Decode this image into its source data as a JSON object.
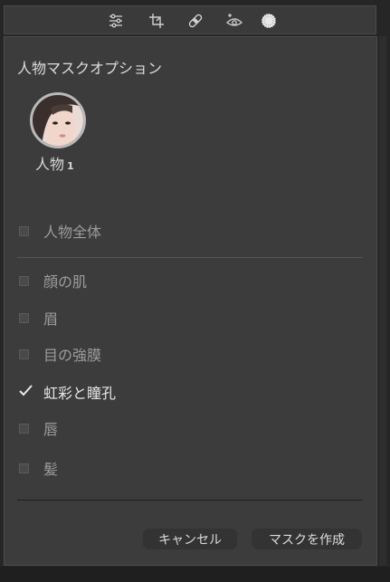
{
  "toolbar": {
    "tools": [
      {
        "name": "sliders-icon",
        "label": "adjust"
      },
      {
        "name": "crop-icon",
        "label": "crop"
      },
      {
        "name": "bandage-icon",
        "label": "heal"
      },
      {
        "name": "red-eye-icon",
        "label": "red-eye"
      },
      {
        "name": "mask-icon",
        "label": "mask"
      }
    ]
  },
  "panel": {
    "title": "人物マスクオプション",
    "person": {
      "name": "人物",
      "index": "1"
    },
    "whole_person": {
      "label": "人物全体",
      "checked": false
    },
    "parts": [
      {
        "label": "顔の肌",
        "checked": false
      },
      {
        "label": "眉",
        "checked": false
      },
      {
        "label": "目の強膜",
        "checked": false
      },
      {
        "label": "虹彩と瞳孔",
        "checked": true
      },
      {
        "label": "唇",
        "checked": false
      },
      {
        "label": "髪",
        "checked": false
      }
    ],
    "buttons": {
      "cancel": "キャンセル",
      "create": "マスクを作成"
    }
  },
  "colors": {
    "panel_bg": "#3c3c3c",
    "text_active": "#e6e6e6",
    "text_inactive": "#9c9c9c"
  }
}
